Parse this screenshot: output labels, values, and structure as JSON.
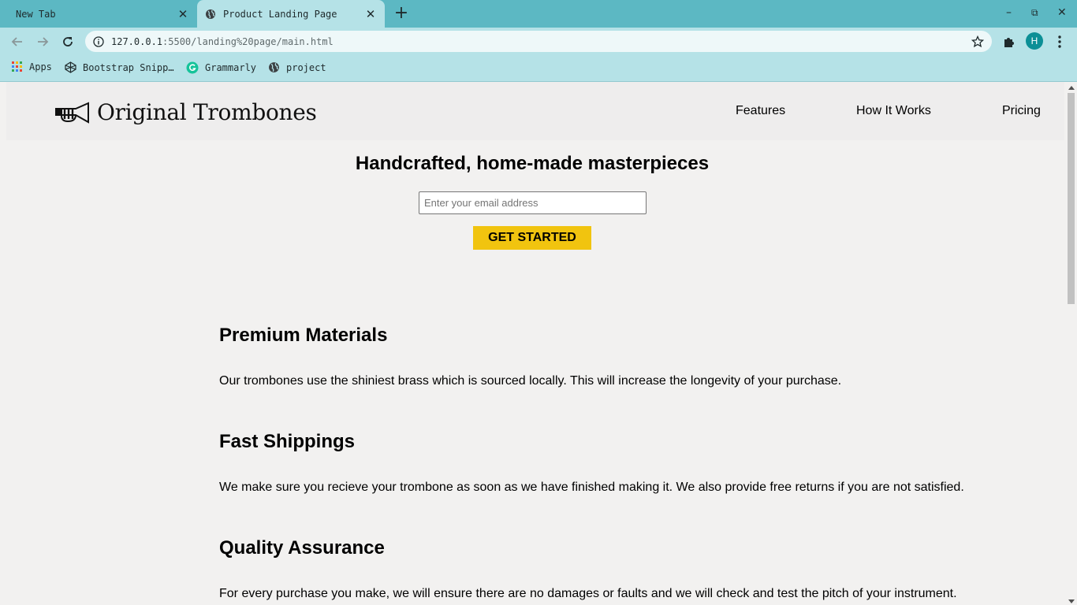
{
  "browser": {
    "tabs": [
      {
        "title": "New Tab"
      },
      {
        "title": "Product Landing Page"
      }
    ],
    "url_host": "127.0.0.1",
    "url_rest": ":5500/landing%20page/main.html",
    "profile_initial": "H",
    "bookmarks": [
      {
        "label": "Apps"
      },
      {
        "label": "Bootstrap Snipp…"
      },
      {
        "label": "Grammarly"
      },
      {
        "label": "project"
      }
    ]
  },
  "page": {
    "brand": "Original Trombones",
    "nav": [
      "Features",
      "How It Works",
      "Pricing"
    ],
    "hero_title": "Handcrafted, home-made masterpieces",
    "email_placeholder": "Enter your email address",
    "cta_label": "GET STARTED",
    "features": [
      {
        "title": "Premium Materials",
        "text": "Our trombones use the shiniest brass which is sourced locally. This will increase the longevity of your purchase."
      },
      {
        "title": "Fast Shippings",
        "text": "We make sure you recieve your trombone as soon as we have finished making it. We also provide free returns if you are not satisfied."
      },
      {
        "title": "Quality Assurance",
        "text": "For every purchase you make, we will ensure there are no damages or faults and we will check and test the pitch of your instrument."
      }
    ]
  },
  "colors": {
    "tabstrip": "#5cb8c3",
    "toolbar": "#b5e2e7",
    "page_bg": "#f2f1f0",
    "cta": "#f1c40f",
    "avatar": "#0b8f96"
  }
}
